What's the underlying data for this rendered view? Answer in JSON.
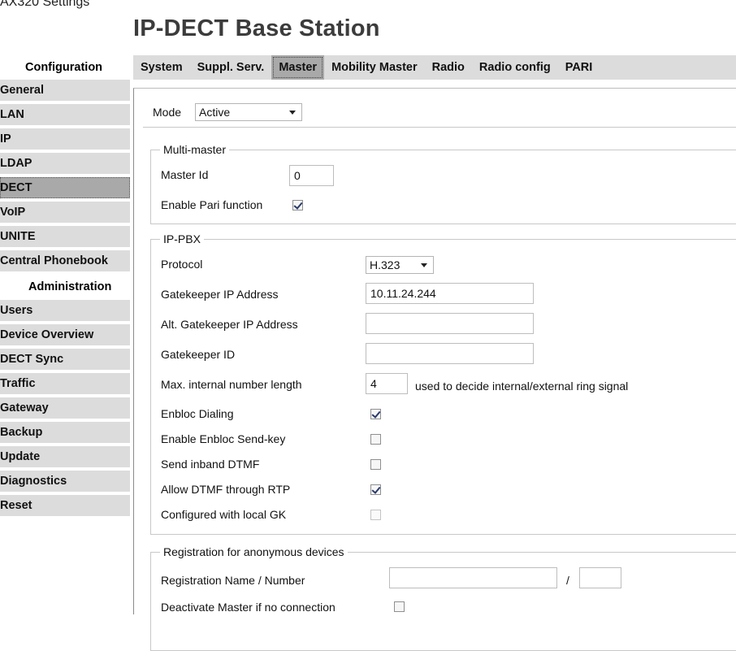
{
  "window": {
    "title": "AX320 Settings",
    "page_title": "IP-DECT Base Station"
  },
  "sidebar": {
    "config_heading": "Configuration",
    "config_items": [
      {
        "label": "General",
        "active": false
      },
      {
        "label": "LAN",
        "active": false
      },
      {
        "label": "IP",
        "active": false
      },
      {
        "label": "LDAP",
        "active": false
      },
      {
        "label": "DECT",
        "active": true
      },
      {
        "label": "VoIP",
        "active": false
      },
      {
        "label": "UNITE",
        "active": false
      },
      {
        "label": "Central Phonebook",
        "active": false
      }
    ],
    "admin_heading": "Administration",
    "admin_items": [
      {
        "label": "Users"
      },
      {
        "label": "Device Overview"
      },
      {
        "label": "DECT Sync"
      },
      {
        "label": "Traffic"
      },
      {
        "label": "Gateway"
      },
      {
        "label": "Backup"
      },
      {
        "label": "Update"
      },
      {
        "label": "Diagnostics"
      },
      {
        "label": "Reset"
      }
    ]
  },
  "tabs": [
    {
      "label": "System",
      "active": false
    },
    {
      "label": "Suppl. Serv.",
      "active": false
    },
    {
      "label": "Master",
      "active": true
    },
    {
      "label": "Mobility Master",
      "active": false
    },
    {
      "label": "Radio",
      "active": false
    },
    {
      "label": "Radio config",
      "active": false
    },
    {
      "label": "PARI",
      "active": false
    }
  ],
  "mode": {
    "label": "Mode",
    "value": "Active"
  },
  "multi_master": {
    "legend": "Multi-master",
    "master_id_label": "Master Id",
    "master_id_value": "0",
    "enable_pari_label": "Enable Pari function",
    "enable_pari_checked": true
  },
  "ip_pbx": {
    "legend": "IP-PBX",
    "protocol_label": "Protocol",
    "protocol_value": "H.323",
    "gk_ip_label": "Gatekeeper IP Address",
    "gk_ip_value": "10.11.24.244",
    "alt_gk_ip_label": "Alt. Gatekeeper IP Address",
    "alt_gk_ip_value": "",
    "gk_id_label": "Gatekeeper ID",
    "gk_id_value": "",
    "max_len_label": "Max. internal number length",
    "max_len_value": "4",
    "max_len_hint": "used to decide internal/external ring signal",
    "checkboxes": [
      {
        "label": "Enbloc Dialing",
        "checked": true,
        "disabled": false
      },
      {
        "label": "Enable Enbloc Send-key",
        "checked": false,
        "disabled": false
      },
      {
        "label": "Send inband DTMF",
        "checked": false,
        "disabled": false
      },
      {
        "label": "Allow DTMF through RTP",
        "checked": true,
        "disabled": false
      },
      {
        "label": "Configured with local GK",
        "checked": false,
        "disabled": true
      }
    ]
  },
  "registration": {
    "legend": "Registration for anonymous devices",
    "name_label": "Registration Name / Number",
    "name_value": "",
    "separator": "/",
    "number_value": "",
    "deactivate_label": "Deactivate Master if no connection",
    "deactivate_checked": false
  }
}
